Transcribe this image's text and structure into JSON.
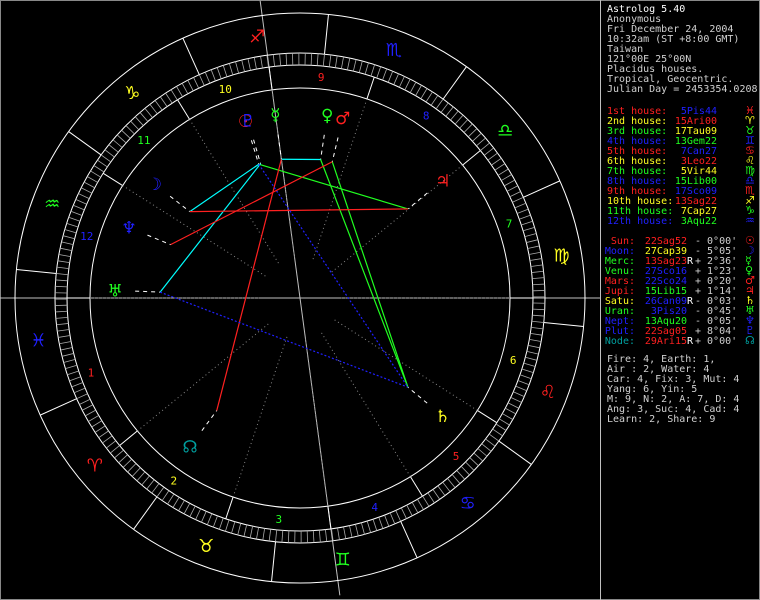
{
  "header": {
    "title": "Astrolog 5.40",
    "name": "Anonymous",
    "date": "Fri December 24, 2004",
    "time": "10:32am (ST +8:00 GMT)",
    "place": "Taiwan",
    "coords": "121°00E 25°00N",
    "houses": "Placidus houses.",
    "zodiac": "Tropical, Geocentric.",
    "julian": "Julian Day = 2453354.0208"
  },
  "colors": {
    "red": "#ff2020",
    "yellow": "#ffff20",
    "green": "#20ff20",
    "blue": "#2020ff",
    "teal": "#00a0a0",
    "white": "#ffffff",
    "gray": "#c0c0c0"
  },
  "house_rows": [
    {
      "label": "1st house:",
      "value": "5Pis44",
      "glyph": "♓",
      "lc": "red",
      "vc": "blue"
    },
    {
      "label": "2nd house:",
      "value": "15Ari00",
      "glyph": "♈",
      "lc": "yellow",
      "vc": "red"
    },
    {
      "label": "3rd house:",
      "value": "17Tau09",
      "glyph": "♉",
      "lc": "green",
      "vc": "yellow"
    },
    {
      "label": "4th house:",
      "value": "13Gem22",
      "glyph": "♊",
      "lc": "blue",
      "vc": "green"
    },
    {
      "label": "5th house:",
      "value": "7Can27",
      "glyph": "♋",
      "lc": "red",
      "vc": "blue"
    },
    {
      "label": "6th house:",
      "value": "3Leo22",
      "glyph": "♌",
      "lc": "yellow",
      "vc": "red"
    },
    {
      "label": "7th house:",
      "value": "5Vir44",
      "glyph": "♍",
      "lc": "green",
      "vc": "yellow"
    },
    {
      "label": "8th house:",
      "value": "15Lib00",
      "glyph": "♎",
      "lc": "blue",
      "vc": "green"
    },
    {
      "label": "9th house:",
      "value": "17Sco09",
      "glyph": "♏",
      "lc": "red",
      "vc": "blue"
    },
    {
      "label": "10th house:",
      "value": "13Sag22",
      "glyph": "♐",
      "lc": "yellow",
      "vc": "red"
    },
    {
      "label": "11th house:",
      "value": "7Cap27",
      "glyph": "♑",
      "lc": "green",
      "vc": "yellow"
    },
    {
      "label": "12th house:",
      "value": "3Aqu22",
      "glyph": "♒",
      "lc": "blue",
      "vc": "green"
    }
  ],
  "planet_rows": [
    {
      "label": "Sun:",
      "value": "22Sag52",
      "retro": "",
      "lat": "- 0°00'",
      "glyph": "☉",
      "lc": "red",
      "vc": "red"
    },
    {
      "label": "Moon:",
      "value": "27Cap39",
      "retro": "",
      "lat": "- 5°05'",
      "glyph": "☽",
      "lc": "blue",
      "vc": "yellow"
    },
    {
      "label": "Merc:",
      "value": "13Sag23",
      "retro": "R",
      "lat": "+ 2°36'",
      "glyph": "☿",
      "lc": "green",
      "vc": "red"
    },
    {
      "label": "Venu:",
      "value": "27Sco16",
      "retro": "",
      "lat": "+ 1°23'",
      "glyph": "♀",
      "lc": "green",
      "vc": "blue"
    },
    {
      "label": "Mars:",
      "value": "22Sco24",
      "retro": "",
      "lat": "+ 0°20'",
      "glyph": "♂",
      "lc": "red",
      "vc": "blue"
    },
    {
      "label": "Jupi:",
      "value": "15Lib15",
      "retro": "",
      "lat": "+ 1°14'",
      "glyph": "♃",
      "lc": "red",
      "vc": "green"
    },
    {
      "label": "Satu:",
      "value": "26Can09",
      "retro": "R",
      "lat": "- 0°03'",
      "glyph": "♄",
      "lc": "yellow",
      "vc": "blue"
    },
    {
      "label": "Uran:",
      "value": "3Pis20",
      "retro": "",
      "lat": "- 0°45'",
      "glyph": "♅",
      "lc": "green",
      "vc": "blue"
    },
    {
      "label": "Nept:",
      "value": "13Aqu20",
      "retro": "",
      "lat": "- 0°05'",
      "glyph": "♆",
      "lc": "blue",
      "vc": "green"
    },
    {
      "label": "Plut:",
      "value": "22Sag05",
      "retro": "",
      "lat": "+ 8°04'",
      "glyph": "♇",
      "lc": "blue",
      "vc": "red"
    },
    {
      "label": "Node:",
      "value": "29Ari15",
      "retro": "R",
      "lat": "+ 0°00'",
      "glyph": "☊",
      "lc": "teal",
      "vc": "red"
    }
  ],
  "stats": [
    "Fire: 4, Earth: 1,",
    "Air : 2, Water: 4",
    "Car: 4, Fix: 3, Mut: 4",
    "Yang: 6, Yin: 5",
    "M: 9, N: 2, A: 7, D: 4",
    "Ang: 3, Suc: 4, Cad: 4",
    "Learn: 2, Share: 9"
  ],
  "wheel": {
    "house_numbers": [
      "1",
      "2",
      "3",
      "4",
      "5",
      "6",
      "7",
      "8",
      "9",
      "10",
      "11",
      "12"
    ],
    "sign_glyphs": [
      "♈",
      "♉",
      "♊",
      "♋",
      "♌",
      "♍",
      "♎",
      "♏",
      "♐",
      "♑",
      "♒",
      "♓"
    ]
  }
}
